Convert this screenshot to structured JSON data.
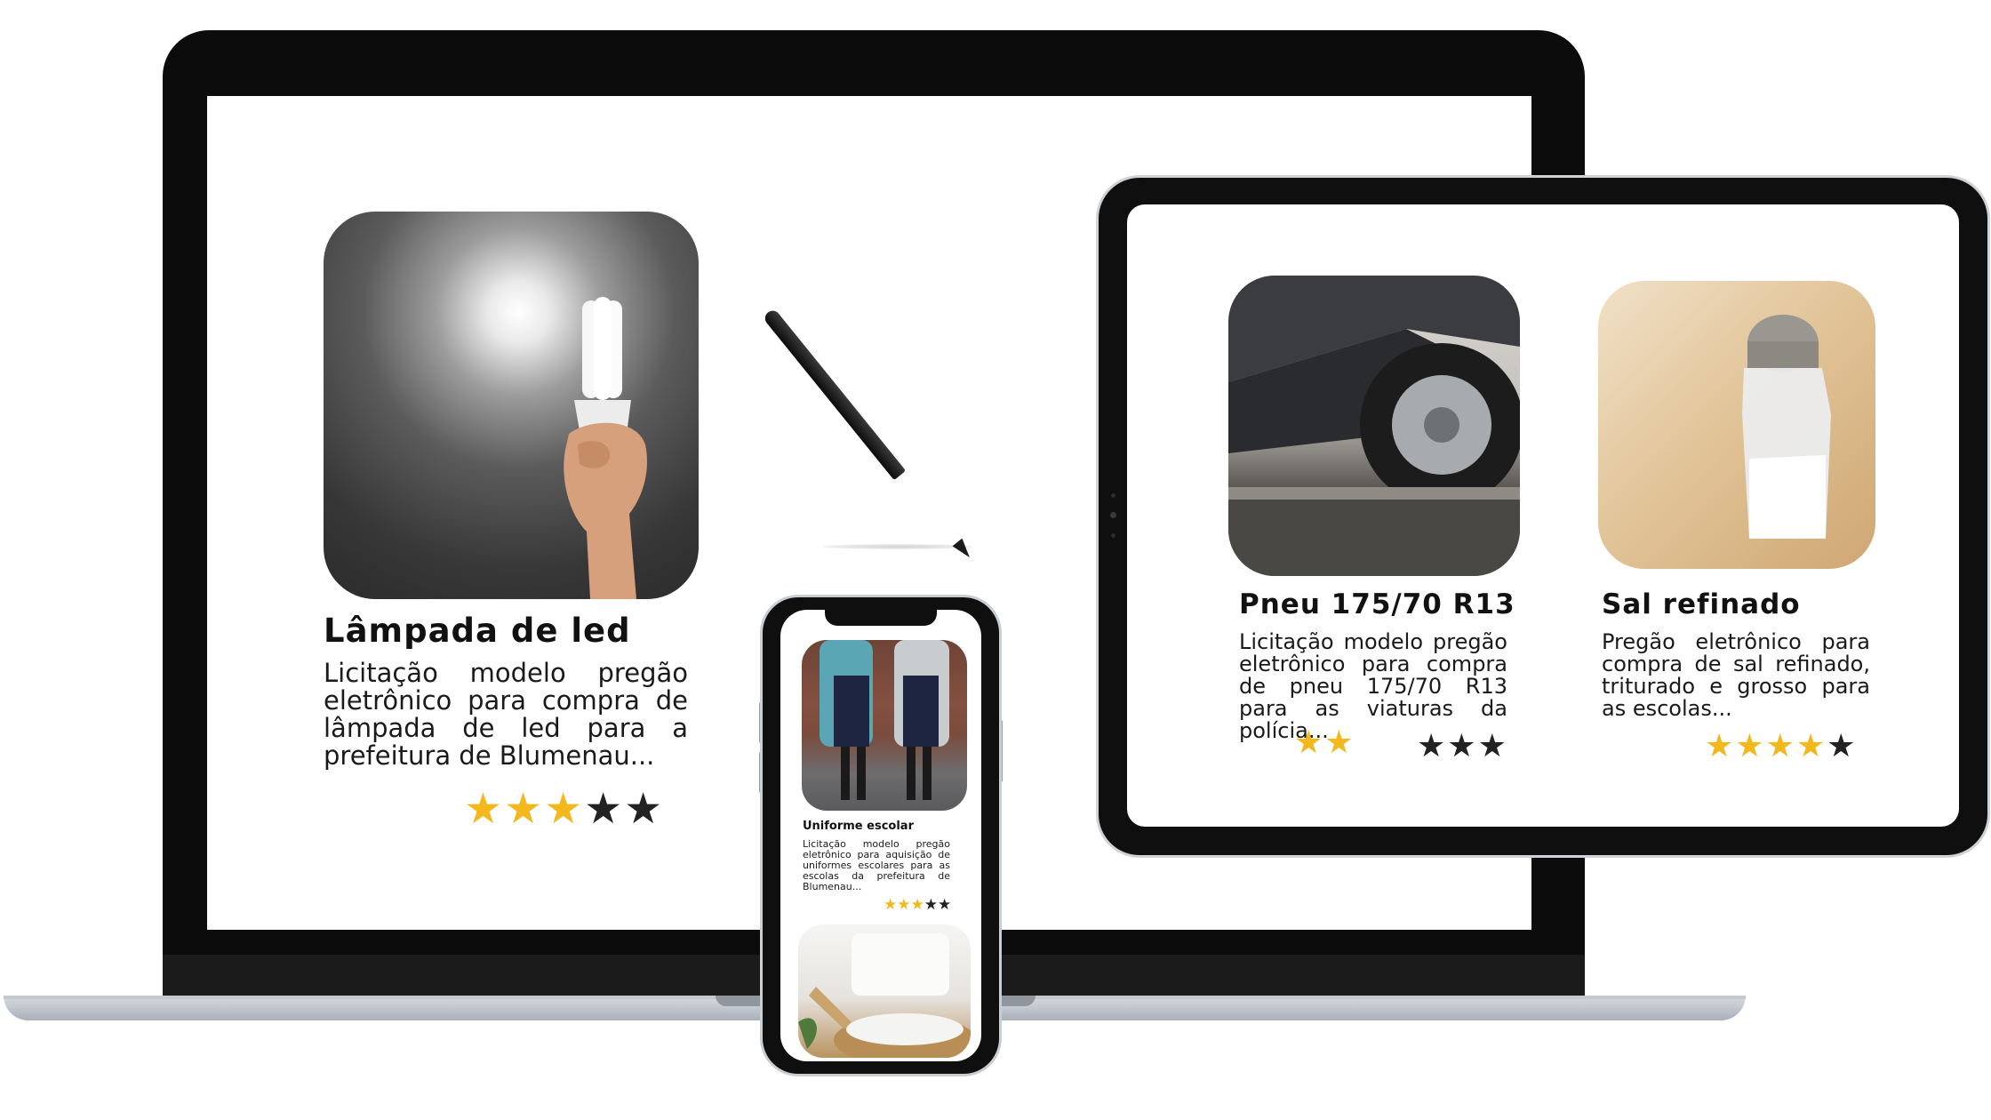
{
  "laptop": {
    "card": {
      "title": "Lâmpada de led",
      "description": "Licitação modelo pregão eletrônico para compra de lâmpada de led para a prefeitura de Blumenau...",
      "rating": 3,
      "rating_max": 5,
      "image_icon": "light-bulb-photo"
    }
  },
  "tablet": {
    "cards": [
      {
        "title": "Pneu 175/70 R13",
        "description": "Licitação modelo pregão eletrônico para compra de pneu 175/70 R13 para as viaturas da polícia...",
        "rating": 2,
        "rating_max": 5,
        "image_icon": "tire-photo"
      },
      {
        "title": "Sal refinado",
        "description": "Pregão eletrônico para compra de sal refinado, triturado e grosso para as escolas...",
        "rating": 4,
        "rating_max": 5,
        "image_icon": "salt-shaker-photo"
      }
    ]
  },
  "phone": {
    "cards": [
      {
        "title": "Uniforme escolar",
        "description": "Licitação modelo pregão eletrônico para aquisição de uniformes escolares para as escolas da prefeitura de Blumenau...",
        "rating": 3,
        "rating_max": 5,
        "image_icon": "school-uniform-photo"
      },
      {
        "image_icon": "salt-bowl-photo"
      }
    ]
  },
  "colors": {
    "star_filled": "#f2b81c",
    "star_empty": "#222222",
    "device_frame": "#0f0f0f"
  },
  "glyphs": {
    "star": "★"
  }
}
